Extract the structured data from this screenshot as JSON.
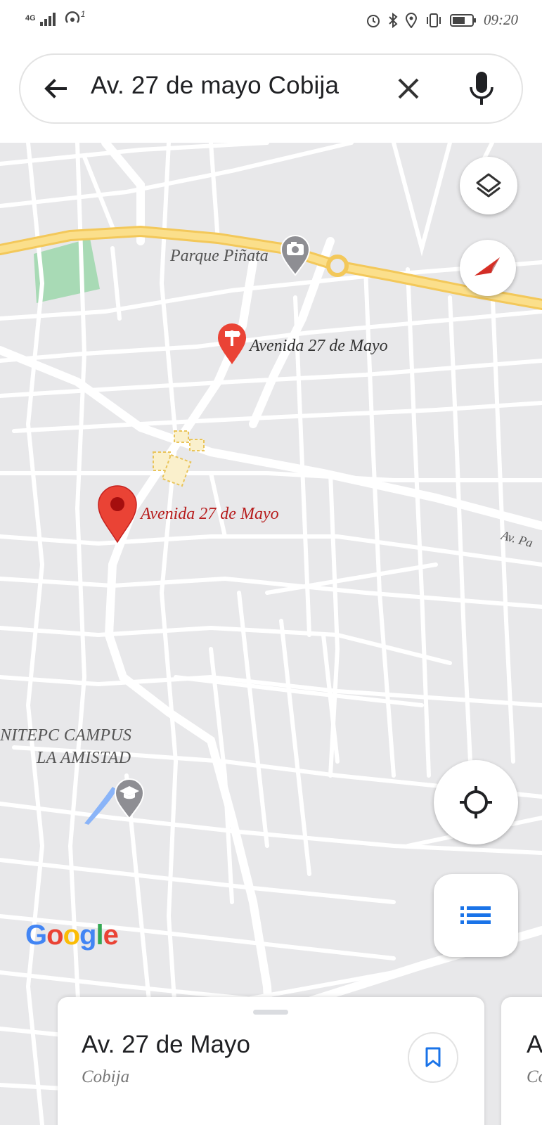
{
  "status_bar": {
    "network": "4G",
    "wifi_sup": "1",
    "time": "09:20"
  },
  "search": {
    "query": "Av. 27 de mayo Cobija"
  },
  "map": {
    "labels": {
      "park": "Parque Piñata",
      "poi": "Avenida 27 de Mayo",
      "main_pin": "Avenida 27 de Mayo",
      "street_partial": "Av. Pa",
      "campus_line1": "NITEPC CAMPUS",
      "campus_line2": "LA AMISTAD"
    },
    "google_logo": [
      "G",
      "o",
      "o",
      "g",
      "l",
      "e"
    ],
    "colors": {
      "road_major": "#f6cf6a",
      "road_minor": "#ffffff",
      "park": "#a8dab5",
      "pin": "#ea4335",
      "accent": "#1a73e8"
    }
  },
  "result_card": {
    "title": "Av. 27 de Mayo",
    "subtitle": "Cobija"
  },
  "next_card": {
    "title": "A",
    "subtitle": "Co"
  },
  "icons": [
    "back-arrow-icon",
    "clear-icon",
    "mic-icon",
    "layers-icon",
    "compass-icon",
    "my-location-icon",
    "list-icon",
    "bookmark-icon",
    "pin-icon",
    "camera-icon",
    "school-icon"
  ]
}
